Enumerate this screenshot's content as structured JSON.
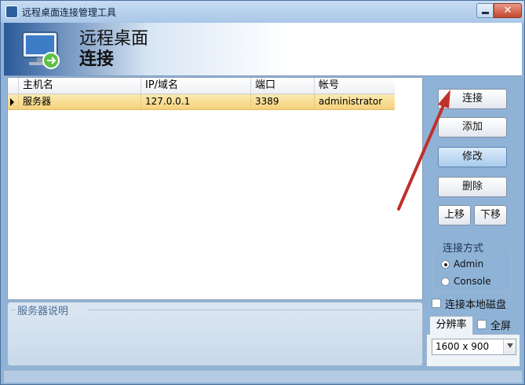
{
  "window": {
    "title": "远程桌面连接管理工具",
    "close_label": "✕"
  },
  "banner": {
    "title_line1": "远程桌面",
    "title_line2": "连接"
  },
  "table": {
    "columns": [
      "主机名",
      "IP/域名",
      "端口",
      "帐号"
    ],
    "rows": [
      {
        "host": "服务器",
        "ip": "127.0.0.1",
        "port": "3389",
        "account": "administrator"
      }
    ]
  },
  "desc": {
    "label": "服务器说明"
  },
  "buttons": {
    "connect": "连接",
    "add": "添加",
    "edit": "修改",
    "delete": "删除",
    "move_up": "上移",
    "move_down": "下移"
  },
  "connect_mode": {
    "label": "连接方式",
    "options": [
      "Admin",
      "Console"
    ],
    "selected": "Admin"
  },
  "local_disk": {
    "label": "连接本地磁盘",
    "checked": false
  },
  "resolution": {
    "tab_label": "分辨率",
    "fullscreen_label": "全屏",
    "fullscreen_checked": false,
    "value": "1600 x 900"
  },
  "colors": {
    "accent": "#2a5a9a",
    "selected_row": "#f6d27b",
    "arrow": "#c0302b"
  }
}
